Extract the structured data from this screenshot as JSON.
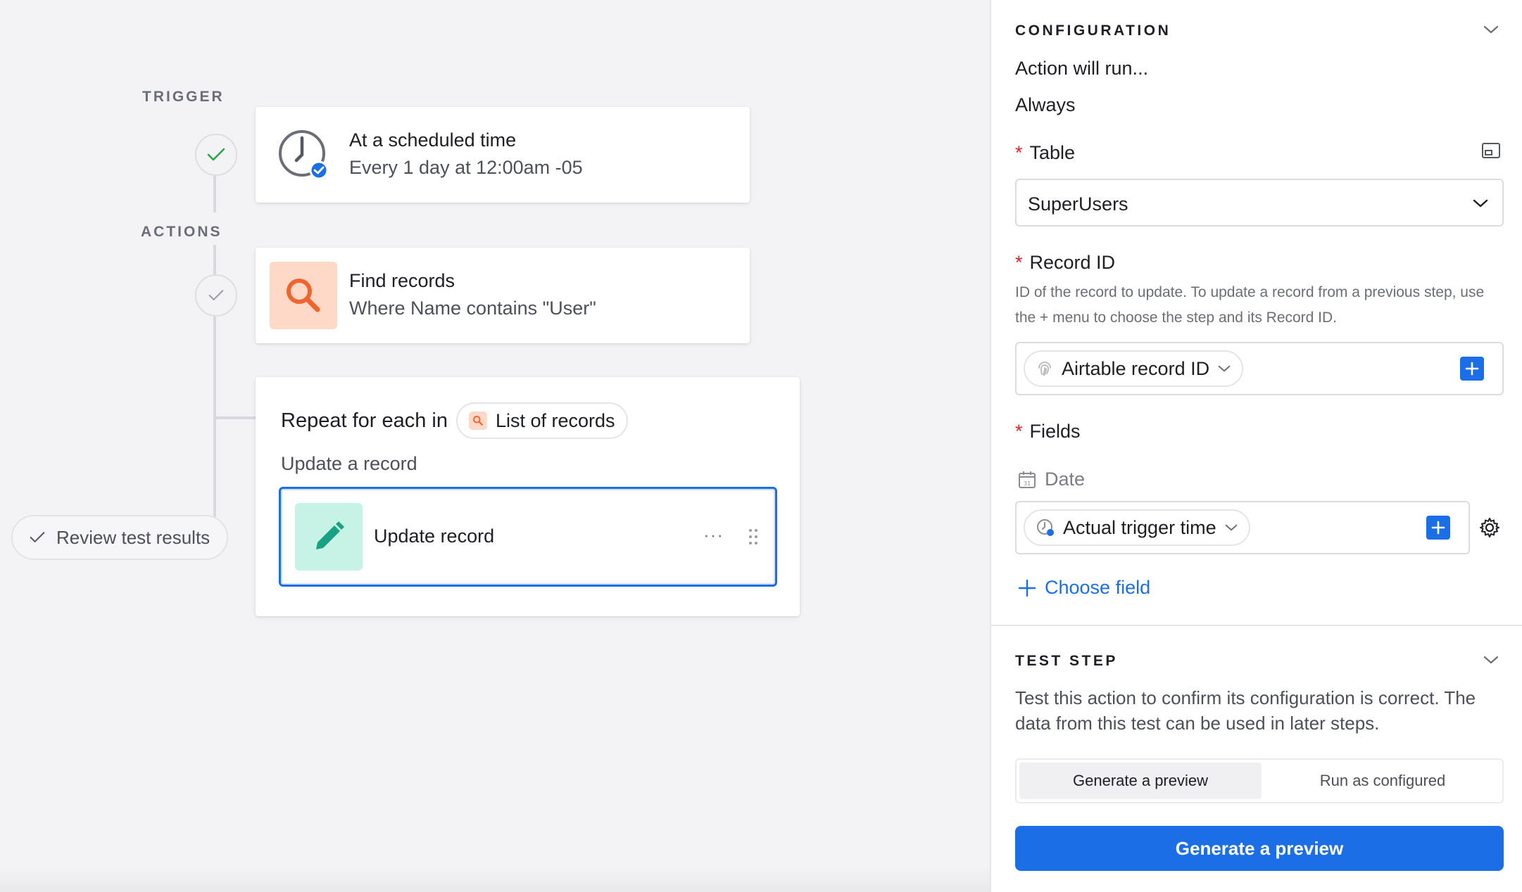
{
  "canvas": {
    "trigger_label": "TRIGGER",
    "actions_label": "ACTIONS",
    "trigger_card": {
      "title": "At a scheduled time",
      "subtitle": "Every 1 day at 12:00am -05"
    },
    "find_card": {
      "title": "Find records",
      "subtitle": "Where Name contains \"User\""
    },
    "repeat_card": {
      "title": "Repeat for each in",
      "list_pill": "List of records",
      "inner_label": "Update a record",
      "inner_card_title": "Update record",
      "more_glyph": "···"
    },
    "review_button": "Review test results",
    "colors": {
      "find_tile": "#ffd9c8",
      "find_icon": "#f0642e",
      "update_tile": "#c7f3e6",
      "update_icon": "#1aa082",
      "selected_border": "#1b6ee6"
    }
  },
  "panel": {
    "config": {
      "heading": "CONFIGURATION",
      "action_will_run": "Action will run...",
      "run_condition": "Always",
      "table_label": "Table",
      "table_value": "SuperUsers",
      "record_id_label": "Record ID",
      "record_id_hint": "ID of the record to update. To update a record from a previous step, use the + menu to choose the step and its Record ID.",
      "record_id_token": "Airtable record ID",
      "fields_label": "Fields",
      "date_field_name": "Date",
      "date_field_token": "Actual trigger time",
      "choose_field": "Choose field",
      "required_marker": "*"
    },
    "test_step": {
      "heading": "TEST STEP",
      "description": "Test this action to confirm its configuration is correct. The data from this test can be used in later steps.",
      "tabs": [
        "Generate a preview",
        "Run as configured"
      ],
      "selected_tab": "Generate a preview",
      "primary_button": "Generate a preview"
    }
  }
}
